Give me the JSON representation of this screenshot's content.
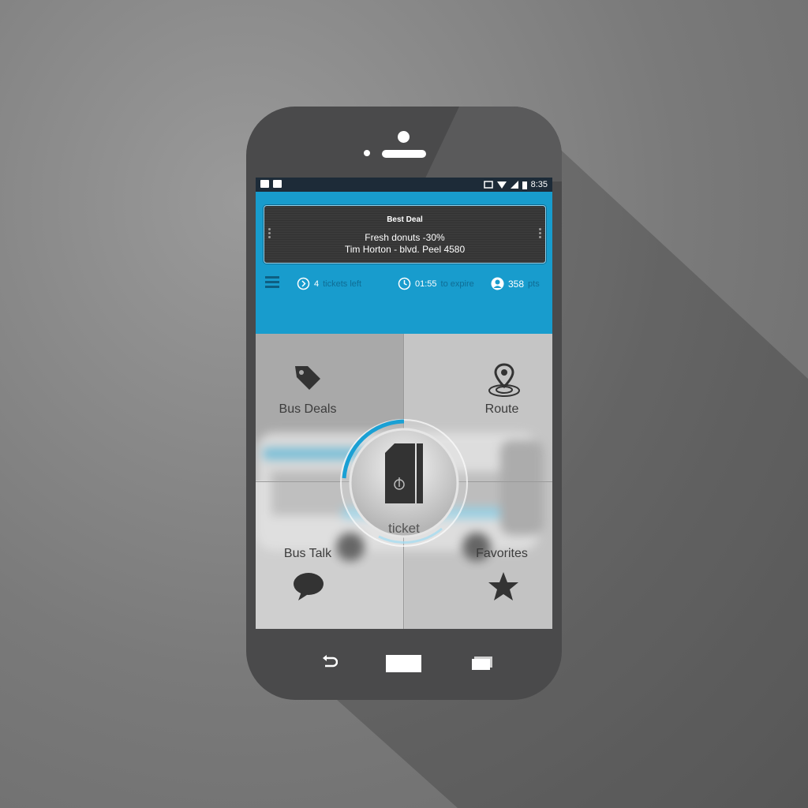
{
  "status_bar": {
    "time": "8:35"
  },
  "best_deal": {
    "title": "Best Deal",
    "line1": "Fresh donuts -30%",
    "line2": "Tim Horton - blvd. Peel 4580"
  },
  "stats": {
    "tickets_count": "4",
    "tickets_label": "tickets left",
    "time_value": "01:55",
    "time_label": "to expire",
    "points_value": "358",
    "points_label": "pts"
  },
  "tiles": {
    "bus_deals": "Bus Deals",
    "route": "Route",
    "bus_talk": "Bus Talk",
    "favorites": "Favorites"
  },
  "ticket_button": {
    "label": "ticket"
  },
  "icons": {
    "bus_deals": "tag-icon",
    "route": "map-pin-icon",
    "bus_talk": "chat-bubble-icon",
    "favorites": "star-icon",
    "ticket": "ticket-icon",
    "menu": "hamburger-icon"
  },
  "colors": {
    "accent": "#189ccd",
    "phone_body": "#4a4a4b",
    "status_bar": "#1d2b38",
    "background": "#7a7a7a"
  }
}
